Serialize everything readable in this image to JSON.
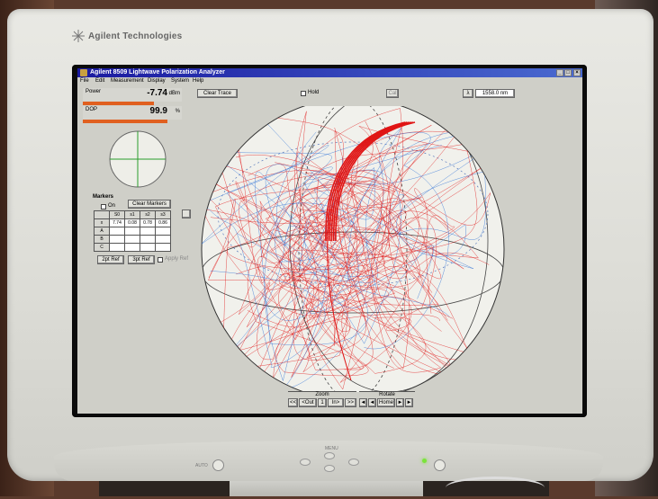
{
  "monitor": {
    "brand": "Agilent Technologies",
    "front_labels": {
      "auto": "AUTO",
      "menu": "MENU"
    },
    "led_color": "#7be43a"
  },
  "app": {
    "title": "Agilent 8509  Lightwave Polarization Analyzer",
    "menu": [
      "File",
      "Edit",
      "Measurement",
      "Display",
      "System",
      "Help"
    ],
    "window_buttons": [
      "_",
      "□",
      "×"
    ],
    "toolbar": {
      "clear_trace": "Clear Trace",
      "hold_label": "Hold",
      "cal_label": "Cal",
      "lambda_symbol": "λ",
      "wavelength": "1558.0 nm"
    },
    "readouts": [
      {
        "name": "Power",
        "value": "-7.74",
        "unit": "dBm",
        "bar_fraction": 0.72
      },
      {
        "name": "DOP",
        "value": "99.9",
        "unit": "%",
        "bar_fraction": 0.85
      }
    ],
    "markers": {
      "title": "Markers",
      "on_label": "On",
      "on_checked": true,
      "clear_button": "Clear Markers",
      "columns": [
        "S0",
        "s1",
        "s2",
        "s3"
      ],
      "rows": [
        {
          "label": "x",
          "values": [
            "7.74",
            "0.08",
            "0.78",
            "0.86"
          ]
        },
        {
          "label": "A",
          "values": [
            "",
            "",
            "",
            ""
          ]
        },
        {
          "label": "B",
          "values": [
            "",
            "",
            "",
            ""
          ]
        },
        {
          "label": "C",
          "values": [
            "",
            "",
            "",
            ""
          ]
        }
      ],
      "two_pt_ref": "2pt Ref",
      "three_pt_ref": "3pt Ref",
      "apply_ref": "Apply Ref"
    },
    "zoom": {
      "label": "Zoom",
      "buttons": [
        "<<",
        "<Out",
        "1",
        "In>",
        ">>"
      ]
    },
    "rotate": {
      "label": "Rotate",
      "buttons": [
        "◄",
        "◄",
        "Home",
        "►",
        "►"
      ]
    },
    "colors": {
      "trace_primary": "#e01515",
      "trace_blue": "#2a6fd6",
      "sphere_grid": "#444444"
    }
  }
}
